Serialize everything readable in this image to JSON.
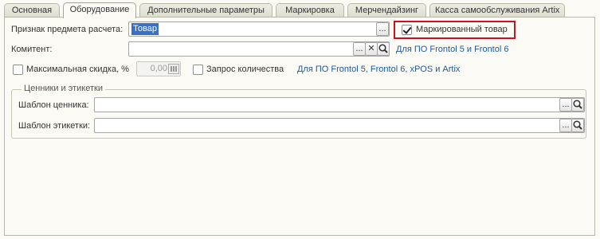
{
  "tabs": [
    {
      "label": "Основная",
      "active": false
    },
    {
      "label": "Оборудование",
      "active": true
    },
    {
      "label": "Дополнительные параметры",
      "active": false
    },
    {
      "label": "Маркировка",
      "active": false
    },
    {
      "label": "Мерчендайзинг",
      "active": false
    },
    {
      "label": "Касса самообслуживания Artix",
      "active": false
    }
  ],
  "form": {
    "payment_subject_label": "Признак предмета расчета:",
    "payment_subject_value": "Товар",
    "marked_goods_label": "Маркированный товар",
    "marked_goods_checked": true,
    "committent_label": "Комитент:",
    "committent_value": "",
    "frontol_note_1": "Для ПО Frontol 5 и Frontol 6",
    "max_discount_label": "Максимальная скидка, %",
    "max_discount_value": "0,00",
    "max_discount_checked": false,
    "quantity_request_label": "Запрос количества",
    "quantity_request_checked": false,
    "frontol_note_2": "Для ПО Frontol 5, Frontol 6, xPOS и Artix"
  },
  "labels_group": {
    "title": "Ценники и этикетки",
    "price_tag_template_label": "Шаблон ценника:",
    "price_tag_template_value": "",
    "label_template_label": "Шаблон этикетки:",
    "label_template_value": ""
  },
  "buttons": {
    "choose": "...",
    "clear": "✕"
  },
  "colors": {
    "highlight": "#c8141e",
    "link": "#1c5aa6",
    "selection": "#3a6fc6"
  }
}
